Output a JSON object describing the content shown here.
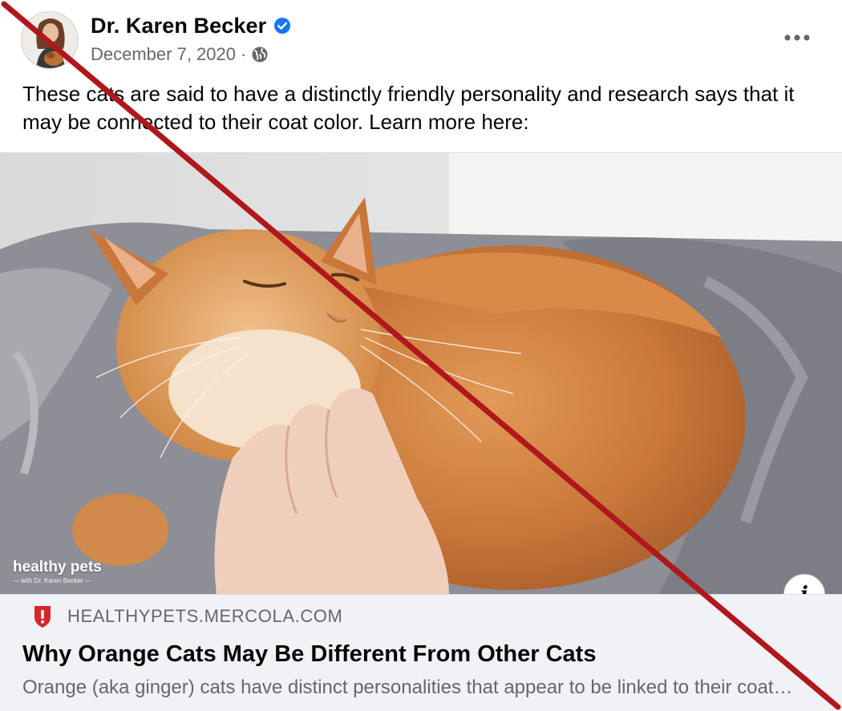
{
  "post": {
    "author": "Dr. Karen Becker",
    "date": "December 7, 2020",
    "separator": "·",
    "audience_icon": "globe-icon",
    "verified_icon": "verified-badge-icon",
    "more_icon": "more-options-icon",
    "text": "These cats are said to have a distinctly friendly personality and research says that it may be connected to their coat color. Learn more here:"
  },
  "link_preview": {
    "image_description_label": "",
    "brand_text": "healthy pets",
    "brand_subtext": "— with Dr. Karen Becker —",
    "info_label": "i",
    "site_icon": "shield-icon",
    "domain": "HEALTHYPETS.MERCOLA.COM",
    "title": "Why Orange Cats May Be Different From Other Cats",
    "description": "Orange (aka ginger) cats have distinct personalities that appear to be linked to their coat color..."
  },
  "colors": {
    "verified_blue": "#1877f2",
    "meta_gray": "#65676b",
    "card_bg": "#f0f2f5",
    "strike_red": "#b0171c",
    "shield_red": "#d8262b"
  }
}
